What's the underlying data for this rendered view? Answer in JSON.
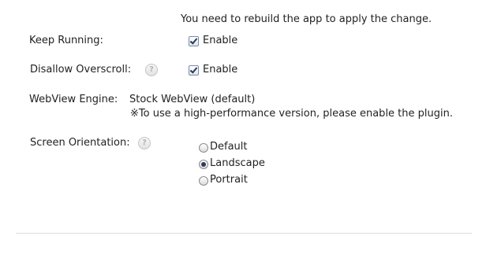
{
  "notice": "You need to rebuild the app to apply the change.",
  "keep_running": {
    "label": "Keep Running:",
    "checkbox_label": "Enable",
    "checked": true
  },
  "disallow_overscroll": {
    "label": "Disallow Overscroll:",
    "help_icon": "?",
    "checkbox_label": "Enable",
    "checked": true
  },
  "webview_engine": {
    "label": "WebView Engine:",
    "value": "Stock WebView (default)",
    "note": "※To use a high-performance version, please enable the plugin."
  },
  "screen_orientation": {
    "label": "Screen Orientation:",
    "help_icon": "?",
    "options": [
      "Default",
      "Landscape",
      "Portrait"
    ],
    "selected": "Landscape"
  }
}
